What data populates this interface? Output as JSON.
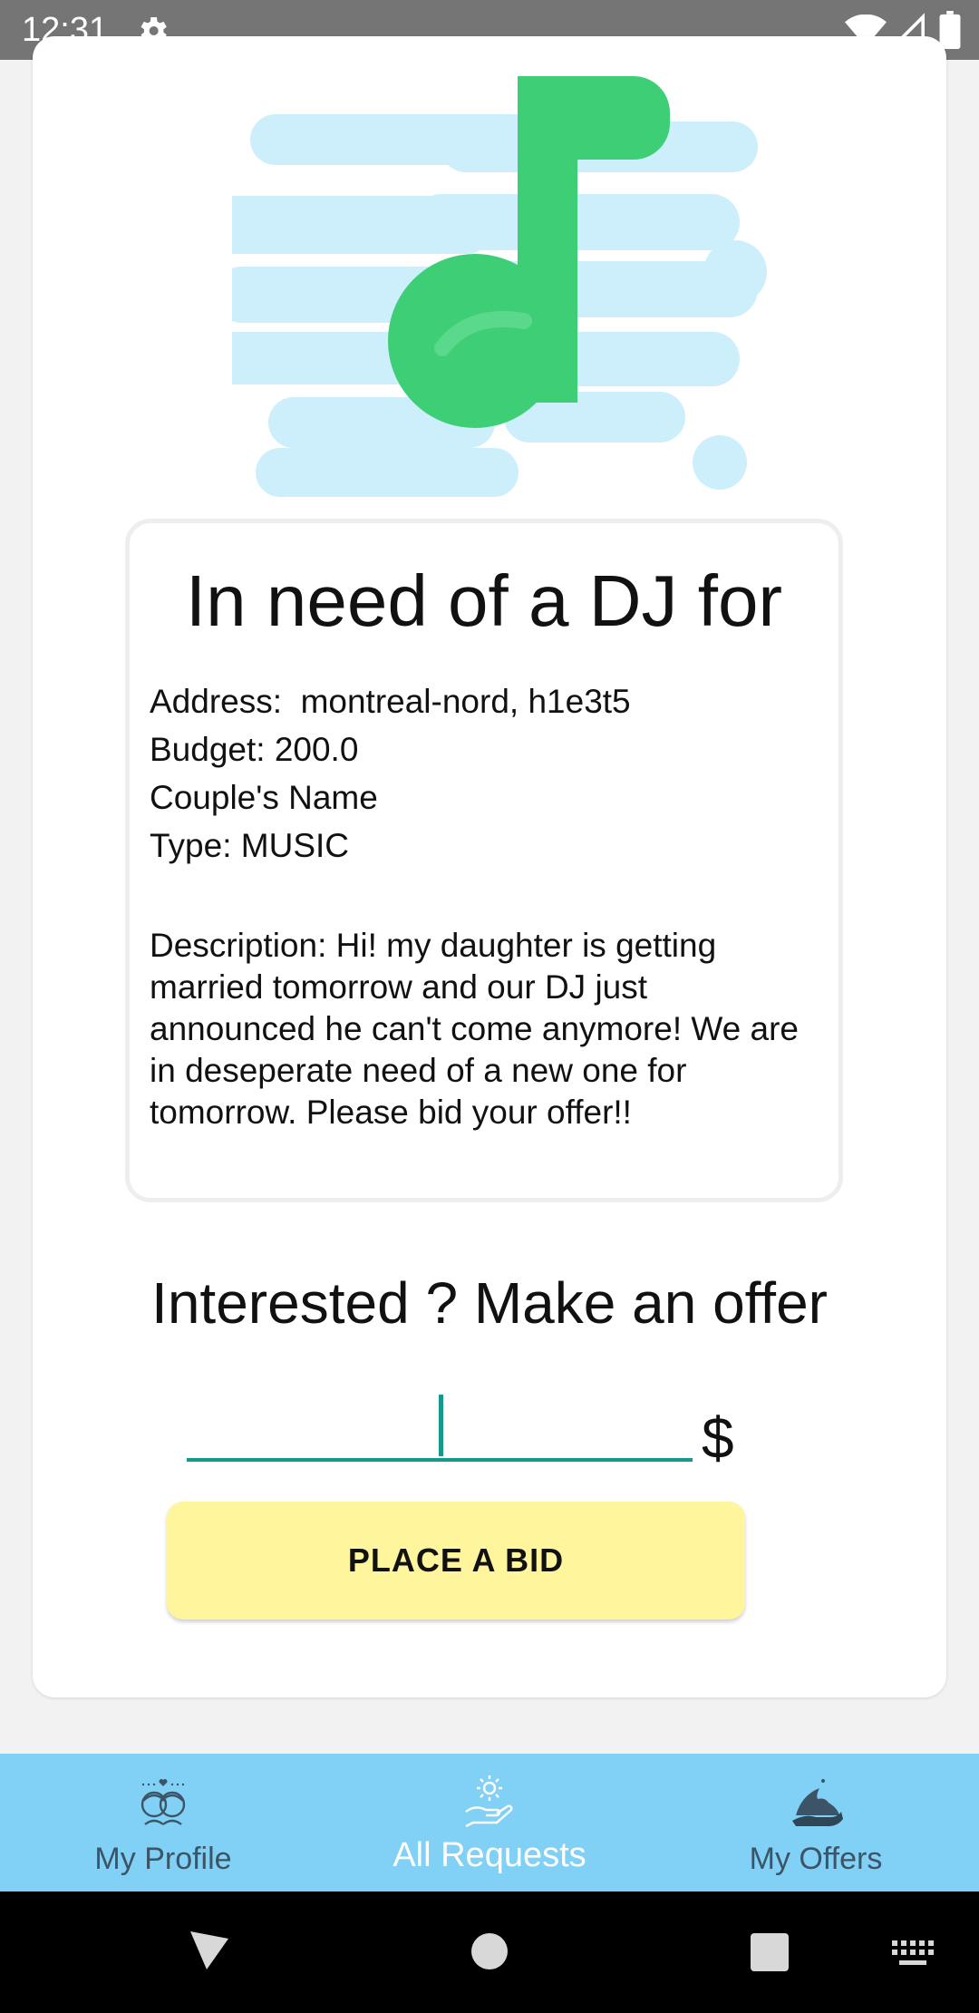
{
  "status_bar": {
    "time": "12:31"
  },
  "request": {
    "title": "In need of a DJ for",
    "address": "Address:  montreal-nord, h1e3t5",
    "budget": "Budget: 200.0",
    "couple_name": "Couple's Name",
    "type": "Type: MUSIC",
    "description": "Description: Hi! my daughter is getting married tomorrow and our DJ just announced he can't come anymore! We are in deseperate need of a new one for tomorrow. Please bid your offer!!"
  },
  "offer": {
    "heading": "Interested ? Make an offer",
    "amount_value": "",
    "currency": "$",
    "button_label": "PLACE A BID"
  },
  "bottom_nav": {
    "items": [
      {
        "label": "My Profile",
        "icon": "couple-icon",
        "active": false
      },
      {
        "label": "All Requests",
        "icon": "hand-gear-icon",
        "active": true
      },
      {
        "label": "My Offers",
        "icon": "hand-shark-icon",
        "active": false
      }
    ]
  },
  "colors": {
    "accent": "#139a8c",
    "button": "#fff59d",
    "nav_background": "#81d0f5",
    "music_green": "#3ecf76",
    "cloud_blue": "#cdeefb"
  }
}
